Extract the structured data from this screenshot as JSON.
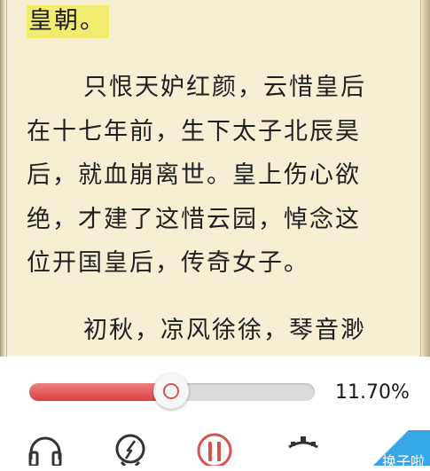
{
  "reader": {
    "lines": [
      "皇朝。",
      "只恨天妒红颜，云惜皇后",
      "在十七年前，生下太子北辰昊",
      "后，就血崩离世。皇上伤心欲",
      "绝，才建了这惜云园，悼念这",
      "位开国皇后，传奇女子。",
      "初秋，凉风徐徐，琴音渺"
    ]
  },
  "controls": {
    "progress_text": "11.70%",
    "progress_fraction": 0.117,
    "corner_label": "换子啦"
  },
  "colors": {
    "page_background": "#f6efd4",
    "highlight": "#f2ec70",
    "accent_red": "#d8534c",
    "corner_blue": "#35a6e6"
  },
  "icons": [
    "headphones-icon",
    "compass-icon",
    "pause-icon",
    "settings-icon"
  ]
}
